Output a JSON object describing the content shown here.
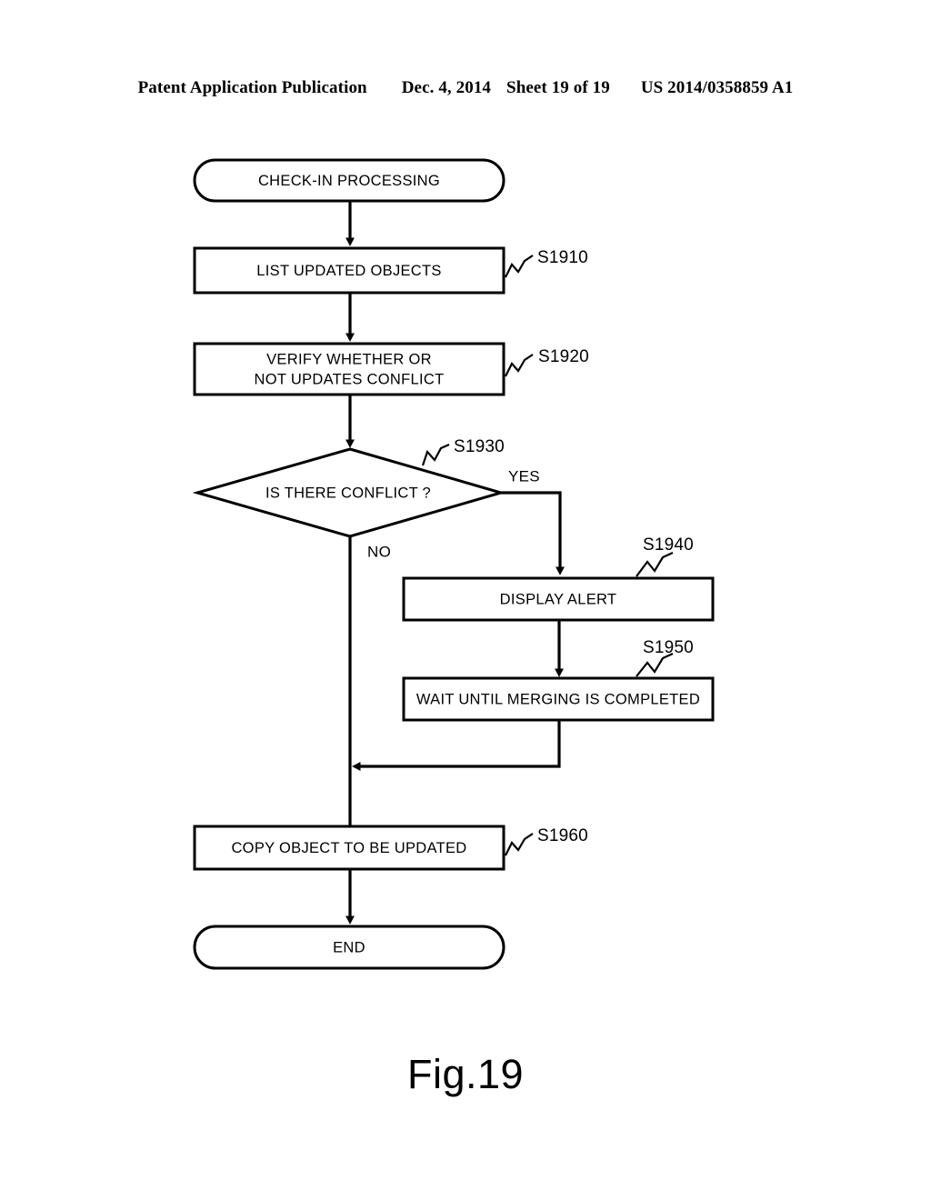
{
  "header": {
    "publication": "Patent Application Publication",
    "date": "Dec. 4, 2014",
    "sheet": "Sheet 19 of 19",
    "number": "US 2014/0358859 A1"
  },
  "figure": {
    "caption": "Fig.19"
  },
  "flowchart": {
    "title": "CHECK-IN PROCESSING",
    "nodes": {
      "start": {
        "label": "CHECK-IN PROCESSING",
        "shape": "terminator"
      },
      "s1910": {
        "label": "LIST UPDATED OBJECTS",
        "shape": "process",
        "step": "S1910"
      },
      "s1920": {
        "label_line1": "VERIFY WHETHER OR",
        "label_line2": "NOT UPDATES CONFLICT",
        "shape": "process",
        "step": "S1920"
      },
      "s1930": {
        "label": "IS THERE CONFLICT ?",
        "shape": "decision",
        "step": "S1930"
      },
      "s1940": {
        "label": "DISPLAY ALERT",
        "shape": "process",
        "step": "S1940"
      },
      "s1950": {
        "label": "WAIT UNTIL MERGING IS COMPLETED",
        "shape": "process",
        "step": "S1950"
      },
      "s1960": {
        "label": "COPY OBJECT TO BE UPDATED",
        "shape": "process",
        "step": "S1960"
      },
      "end": {
        "label": "END",
        "shape": "terminator"
      }
    },
    "branches": {
      "yes": "YES",
      "no": "NO"
    },
    "colors": {
      "stroke": "#000000",
      "fill": "#ffffff",
      "text": "#000000"
    }
  }
}
